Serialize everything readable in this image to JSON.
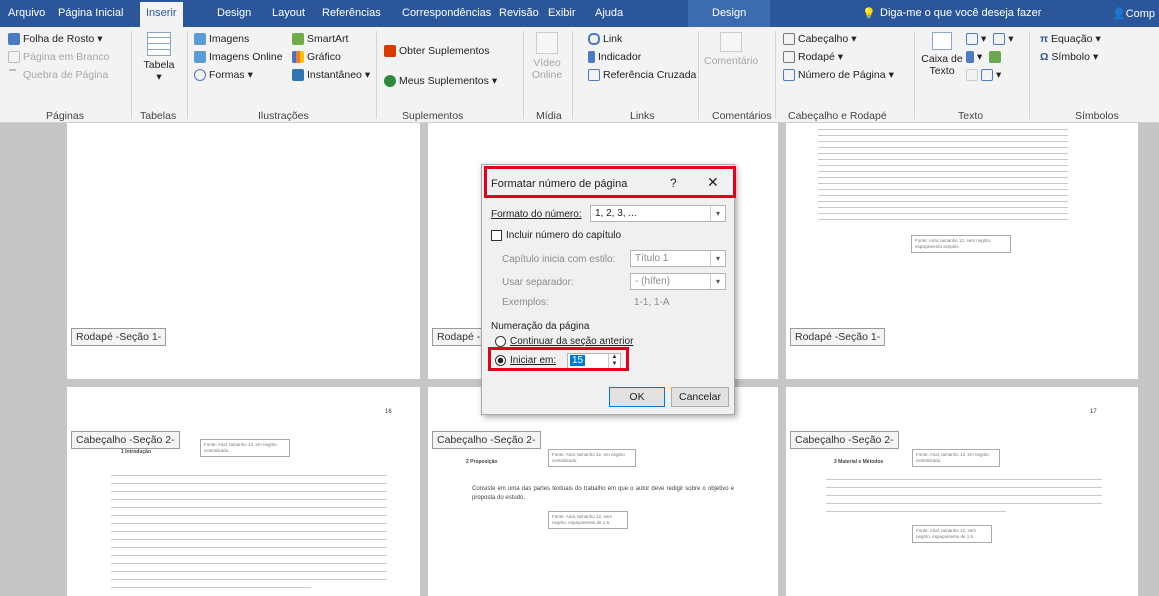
{
  "tabs": [
    "Arquivo",
    "Página Inicial",
    "Inserir",
    "Design",
    "Layout",
    "Referências",
    "Correspondências",
    "Revisão",
    "Exibir",
    "Ajuda",
    "Design"
  ],
  "tell_me": "Diga-me o que você deseja fazer",
  "share": "Comp",
  "ribbon": {
    "paginas": {
      "capa": "Folha de Rosto",
      "branco": "Página em Branco",
      "quebra": "Quebra de Página",
      "group": "Páginas"
    },
    "tabelas": {
      "tabela": "Tabela",
      "group": "Tabelas"
    },
    "ilustracoes": {
      "imagens": "Imagens",
      "online": "Imagens Online",
      "formas": "Formas",
      "smartart": "SmartArt",
      "grafico": "Gráfico",
      "instantaneo": "Instantâneo",
      "group": "Ilustrações"
    },
    "suplementos": {
      "obter": "Obter Suplementos",
      "meus": "Meus Suplementos",
      "group": "Suplementos"
    },
    "midia": {
      "video": "Vídeo Online",
      "group": "Mídia"
    },
    "links": {
      "link": "Link",
      "indicador": "Indicador",
      "referencia": "Referência Cruzada",
      "group": "Links"
    },
    "comentarios": {
      "comentario": "Comentário",
      "group": "Comentários"
    },
    "cabecalho": {
      "cabecalho": "Cabeçalho",
      "rodape": "Rodapé",
      "numero": "Número de Página",
      "group": "Cabeçalho e Rodapé"
    },
    "texto": {
      "caixa": "Caixa de Texto",
      "group": "Texto"
    },
    "simbolos": {
      "equacao": "Equação",
      "simbolo": "Símbolo",
      "group": "Símbolos"
    }
  },
  "doc": {
    "footer_tag": "Rodapé -Seção 1-",
    "footer_tag_short": "Rodapé -S",
    "header_tag": "Cabeçalho -Seção 2-",
    "page_num_left": "16",
    "page_num_right": "17",
    "note_center_bold": "Fonte: Arial, tamanho 12, em negrito centralizado.",
    "note_spacing": "Fonte: Arial, tamanho 12, sem negrito, espaçamento de 1.5.",
    "note_simple": "Fonte: Arial, tamanho 12, sem negrito, espaçamento simples.",
    "h_intro": "1 Introdução",
    "h_prop": "2 Proposição",
    "h_mat": "3 Material e Métodos",
    "mid_text": "Consiste em uma das partes textuais do trabalho em que o autor deve redigir sobre o objetivo e proposta do estudo."
  },
  "dialog": {
    "title": "Formatar número de página",
    "help": "?",
    "close": "✕",
    "formato_label": "Formato do número:",
    "formato_value": "1, 2, 3, ...",
    "incluir": "Incluir número do capítulo",
    "capitulo_label": "Capítulo inicia com estilo:",
    "capitulo_value": "Título 1",
    "separador_label": "Usar separador:",
    "separador_value": "-  (hífen)",
    "exemplos_label": "Exemplos:",
    "exemplos_value": "1-1, 1-A",
    "numeracao": "Numeração da página",
    "continuar": "Continuar da seção anterior",
    "iniciar": "Iniciar em:",
    "iniciar_value": "15",
    "ok": "OK",
    "cancelar": "Cancelar"
  },
  "colors": {
    "title_bar": "#2b579a",
    "highlight": "#e0001b",
    "ribbon_bg": "#f3f3f3"
  }
}
